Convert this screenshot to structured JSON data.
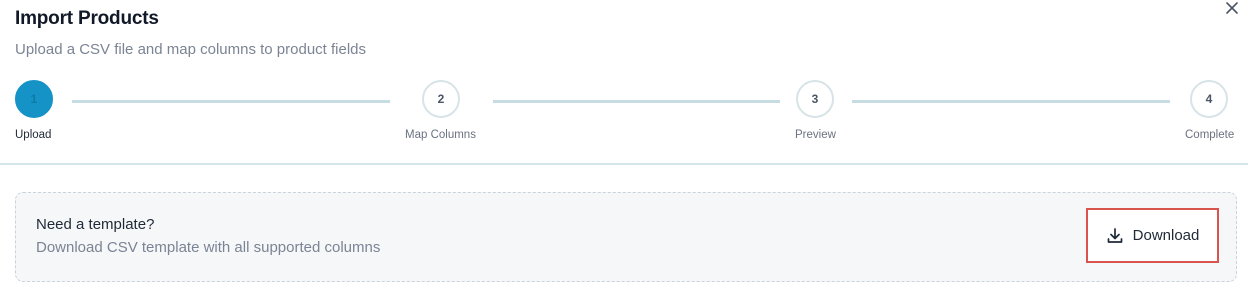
{
  "dialog": {
    "title": "Import Products",
    "subtitle": "Upload a CSV file and map columns to product fields",
    "close_icon": "close-icon"
  },
  "stepper": {
    "current_step": 1,
    "steps": [
      {
        "number": "1",
        "label": "Upload",
        "state": "active"
      },
      {
        "number": "2",
        "label": "Map Columns",
        "state": "pending"
      },
      {
        "number": "3",
        "label": "Preview",
        "state": "pending"
      },
      {
        "number": "4",
        "label": "Complete",
        "state": "pending"
      }
    ]
  },
  "template": {
    "title": "Need a template?",
    "description": "Download CSV template with all supported columns",
    "download_label": "Download",
    "download_icon": "download-icon"
  },
  "colors": {
    "accent": "#1592c6",
    "highlight_border": "#d9534f",
    "connector": "#c5dde2"
  }
}
